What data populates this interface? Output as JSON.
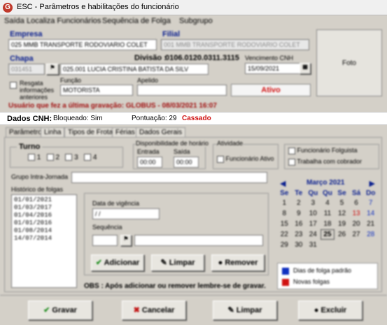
{
  "window": {
    "title": "ESC - Parâmetros e habilitações do funcionário"
  },
  "menu": [
    "Saída",
    "Localiza Funcionários",
    "Sequência de Folga",
    "Subgrupo"
  ],
  "empresa": {
    "label": "Empresa",
    "value": "025 MMB TRANSPORTE RODOVIARIO COLET"
  },
  "filial": {
    "label": "Filial",
    "value": "001 MMB TRANSPORTE RODOVIARIO COLET"
  },
  "chapa": {
    "label": "Chapa",
    "value": "031451",
    "nome": "025.001 LUCIA CRISTINA BATISTA DA SILV"
  },
  "divisao": {
    "label": "Divisão :",
    "value": "0106.0120.0311.3115"
  },
  "vencimento": {
    "label": "Vencimento CNH",
    "value": "15/09/2021"
  },
  "foto": "Foto",
  "resgata": "Resgata informações anteriores",
  "funcao": {
    "label": "Função",
    "value": "MOTORISTA"
  },
  "apelido": {
    "label": "Apelido",
    "value": ""
  },
  "status": "Ativo",
  "ultima_gravacao": "Usuário que fez a última gravação: GLOBUS - 08/03/2021 16:07",
  "cnh_bar": {
    "label": "Dados CNH:",
    "bloqueado": "Bloqueado: Sim",
    "pontuacao": "Pontuação: 29",
    "cassado": "Cassado"
  },
  "tabs": [
    "Parâmetros",
    "Linha",
    "Tipos de Frota",
    "Férias",
    "Dados Gerais"
  ],
  "turno": {
    "label": "Turno",
    "options": [
      "1",
      "2",
      "3",
      "4"
    ]
  },
  "disponibilidade": {
    "label": "Disponibilidade de horário",
    "entrada_label": "Entrada",
    "entrada": "00:00",
    "saida_label": "Saída",
    "saida": "00:00"
  },
  "atividade": {
    "label": "Atividade",
    "funcionario_ativo": "Funcionário Ativo"
  },
  "folguista": "Funcionário Folguista",
  "trabalha_cobrador": "Trabalha com cobrador",
  "grupo_intrajornada": "Grupo Intra-Jornada",
  "historico": {
    "label": "Histórico de folgas",
    "items": [
      "01/01/2021",
      "01/03/2017",
      "01/04/2016",
      "01/01/2016",
      "01/08/2014",
      "14/07/2014"
    ]
  },
  "vigencia": {
    "label": "Data de vigência",
    "value": "/ /",
    "sequencia_label": "Sequência"
  },
  "buttons": {
    "adicionar": "Adicionar",
    "limpar": "Limpar",
    "remover": "Remover"
  },
  "obs": "OBS : Após adicionar ou remover lembre-se de gravar.",
  "calendar": {
    "month": "Março 2021",
    "days": [
      "Se",
      "Te",
      "Qu",
      "Qu",
      "Se",
      "Sá",
      "Do"
    ],
    "weeks": [
      [
        "1",
        "2",
        "3",
        "4",
        "5",
        "6",
        "7"
      ],
      [
        "8",
        "9",
        "10",
        "11",
        "12",
        "13",
        "14"
      ],
      [
        "15",
        "16",
        "17",
        "18",
        "19",
        "20",
        "21"
      ],
      [
        "22",
        "23",
        "24",
        "25",
        "26",
        "27",
        "28"
      ],
      [
        "29",
        "30",
        "31",
        "",
        "",
        "",
        ""
      ]
    ]
  },
  "legend": {
    "padrao": "Dias de folga padrão",
    "novas": "Novas folgas",
    "padrao_color": "#1030c0",
    "novas_color": "#d01010"
  },
  "footer": {
    "gravar": "Gravar",
    "cancelar": "Cancelar",
    "limpar": "Limpar",
    "excluir": "Excluir"
  },
  "colors": {
    "cassado": "#d01010",
    "label_blue": "#0a1f8f",
    "warning": "#a01010"
  }
}
